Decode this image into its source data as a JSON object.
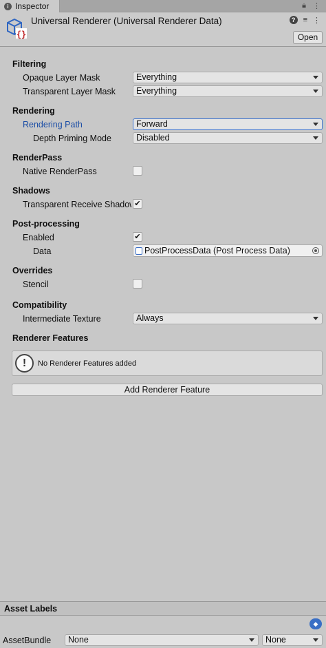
{
  "tab": {
    "label": "Inspector"
  },
  "header": {
    "title": "Universal Renderer (Universal Renderer Data)",
    "open_label": "Open"
  },
  "filtering": {
    "title": "Filtering",
    "opaque_label": "Opaque Layer Mask",
    "opaque_value": "Everything",
    "transparent_label": "Transparent Layer Mask",
    "transparent_value": "Everything"
  },
  "rendering": {
    "title": "Rendering",
    "path_label": "Rendering Path",
    "path_value": "Forward",
    "depth_label": "Depth Priming Mode",
    "depth_value": "Disabled"
  },
  "renderpass": {
    "title": "RenderPass",
    "native_label": "Native RenderPass",
    "native_checked": false
  },
  "shadows": {
    "title": "Shadows",
    "receive_label": "Transparent Receive Shadows",
    "receive_checked": true
  },
  "postprocessing": {
    "title": "Post-processing",
    "enabled_label": "Enabled",
    "enabled_checked": true,
    "data_label": "Data",
    "data_value": "PostProcessData (Post Process Data)"
  },
  "overrides": {
    "title": "Overrides",
    "stencil_label": "Stencil",
    "stencil_checked": false
  },
  "compatibility": {
    "title": "Compatibility",
    "intermediate_label": "Intermediate Texture",
    "intermediate_value": "Always"
  },
  "features": {
    "title": "Renderer Features",
    "empty_message": "No Renderer Features added",
    "add_label": "Add Renderer Feature"
  },
  "asset_labels": {
    "title": "Asset Labels",
    "bundle_label": "AssetBundle",
    "bundle_value": "None",
    "variant_value": "None"
  },
  "colors": {
    "accent": "#3a72d0",
    "label_blue": "#1c4ea6",
    "background": "#c8c8c8"
  }
}
